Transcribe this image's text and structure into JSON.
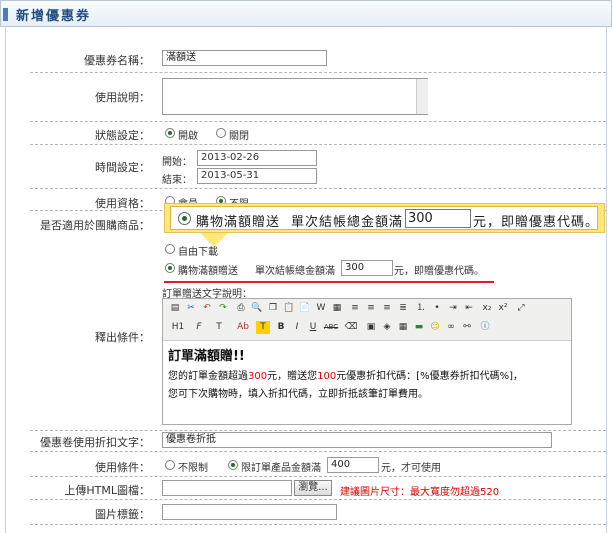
{
  "header": {
    "title": "新增優惠券"
  },
  "fields": {
    "name": {
      "label": "優惠券名稱：",
      "value": "滿額送"
    },
    "desc": {
      "label": "使用說明：",
      "value": ""
    },
    "status": {
      "label": "狀態設定：",
      "opt_on": "開啟",
      "opt_off": "關閉",
      "selected": "開啟"
    },
    "time": {
      "label": "時間設定：",
      "start_label": "開始：",
      "start": "2013-02-26",
      "end_label": "結束：",
      "end": "2013-05-31"
    },
    "qualify": {
      "label": "使用資格：",
      "opt_member": "會員",
      "opt_all": "不限"
    },
    "group": {
      "label": "是否適用於團購商品："
    },
    "output": {
      "label": "釋出條件：",
      "opt_free": "自由下載",
      "opt_spend": "購物滿額贈送",
      "spend_prefix": "單次結帳總金額滿",
      "spend_value": "300",
      "spend_suffix": "元，即贈優惠代碼。",
      "selected": "購物滿額贈送",
      "order_text_label": "訂單贈送文字說明："
    },
    "discount_text": {
      "label": "優惠卷使用折扣文字：",
      "value": "優惠卷折抵"
    },
    "use_cond": {
      "label": "使用條件：",
      "opt_unlimited": "不限制",
      "opt_min": "限訂單產品金額滿",
      "min_value": "400",
      "min_suffix": "元，才可使用",
      "selected": "限訂單產品金額滿"
    },
    "upload": {
      "label": "上傳HTML圖檔：",
      "browse": "瀏覽...",
      "hint": "建議圖片尺寸：最大寬度勿超過520"
    },
    "img_tag": {
      "label": "圖片標籤：",
      "value": ""
    }
  },
  "callout": {
    "opt": "購物滿額贈送",
    "prefix": "單次結帳總金額滿",
    "value": "300",
    "suffix": "元，即贈優惠代碼。"
  },
  "editor": {
    "heading": "訂單滿額贈!!",
    "line1_a": "您的訂單金額超過",
    "line1_amt": "300",
    "line1_b": "元，贈送您",
    "line1_amt2": "100",
    "line1_c": "元優惠折扣代碼：[%優惠券折扣代碼%]，",
    "line2": "您可下次購物時，填入折扣代碼，立即折抵該筆訂單費用。",
    "toolbar_row2": [
      "H1",
      "F",
      "T",
      "Ab",
      "T",
      "B",
      "I",
      "U",
      "ABC"
    ]
  },
  "colors": {
    "accent": "#1f4f84",
    "callout": "#ffe77a",
    "alert": "#e02020"
  }
}
